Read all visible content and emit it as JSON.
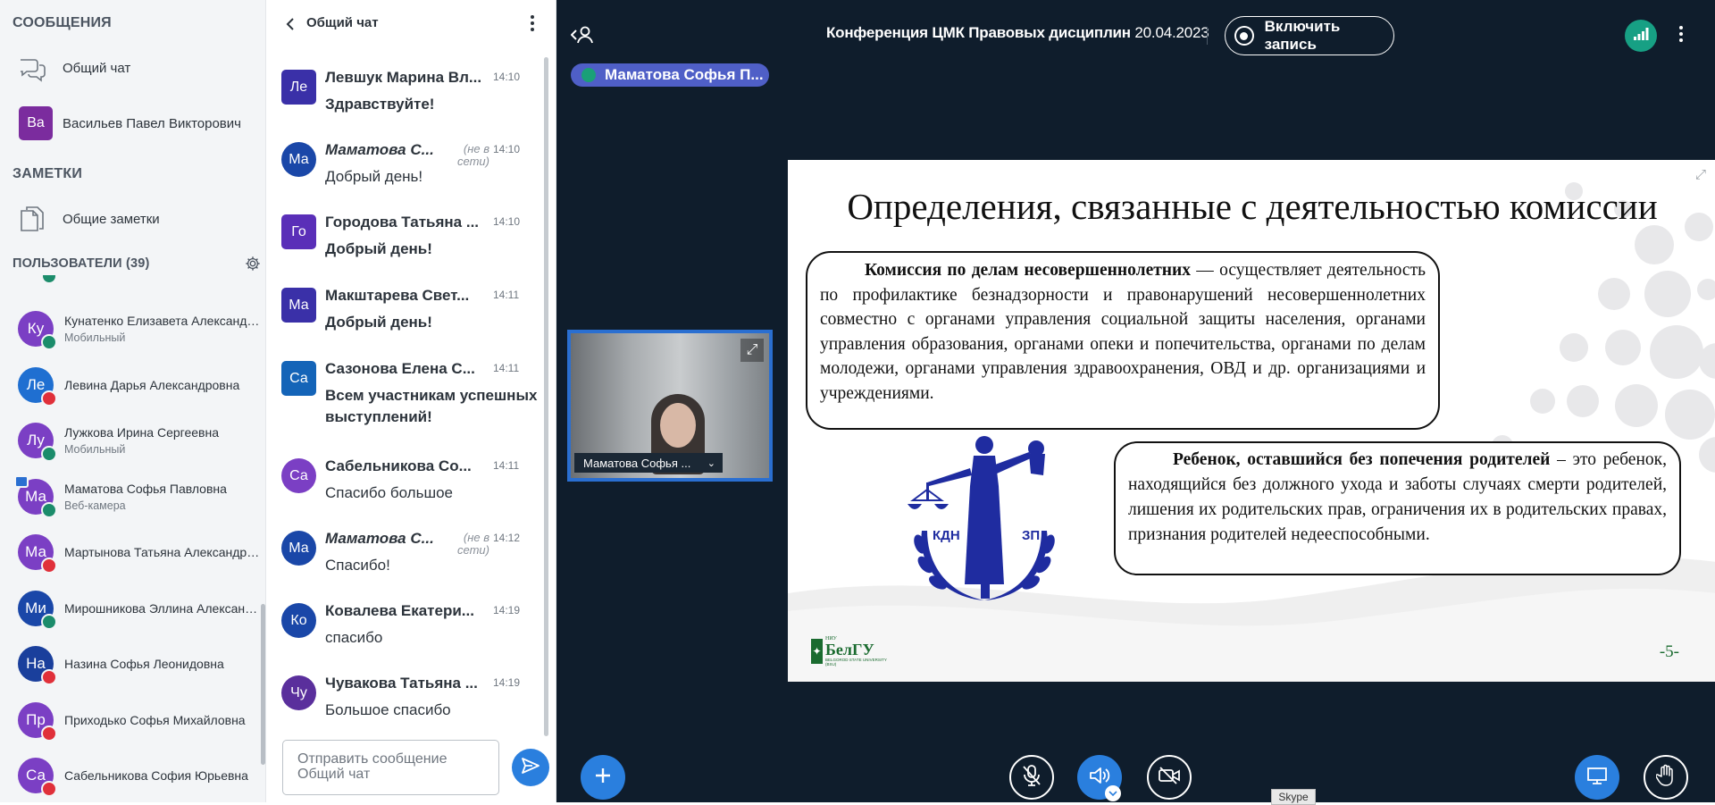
{
  "sidebar": {
    "messages_title": "СООБЩЕНИЯ",
    "public_chat_label": "Общий чат",
    "private_chat": {
      "initials": "Ва",
      "name": "Васильев Павел Викторович",
      "color": "#7b2c9e"
    },
    "notes_title": "ЗАМЕТКИ",
    "shared_notes_label": "Общие заметки",
    "users_title": "ПОЛЬЗОВАТЕЛИ (39)",
    "users": [
      {
        "initials": "Ку",
        "name": "Кунатенко Елизавета Александровна",
        "sub": "Мобильный",
        "color": "#7b3fc4",
        "status": "mic"
      },
      {
        "initials": "Ле",
        "name": "Левина Дарья Александровна",
        "sub": "",
        "color": "#1f6fd1",
        "status": "muted"
      },
      {
        "initials": "Лу",
        "name": "Лужкова Ирина Сергеевна",
        "sub": "Мобильный",
        "color": "#7b3fc4",
        "status": "mic"
      },
      {
        "initials": "Ма",
        "name": "Маматова Софья Павловна",
        "sub": "Веб-камера",
        "color": "#7b3fc4",
        "status": "mic"
      },
      {
        "initials": "Ма",
        "name": "Мартынова Татьяна Александровна",
        "sub": "",
        "color": "#7b3fc4",
        "status": "muted"
      },
      {
        "initials": "Ми",
        "name": "Мирошникова Эллина Александровна",
        "sub": "",
        "color": "#1a47a8",
        "status": "mic"
      },
      {
        "initials": "На",
        "name": "Назина Софья Леонидовна",
        "sub": "",
        "color": "#1a3f9c",
        "status": "muted"
      },
      {
        "initials": "Пр",
        "name": "Приходько Софья Михайловна",
        "sub": "",
        "color": "#7b3fc4",
        "status": "muted"
      },
      {
        "initials": "Са",
        "name": "Сабельникова София Юрьевна",
        "sub": "",
        "color": "#7b3fc4",
        "status": "muted"
      }
    ]
  },
  "chat": {
    "title": "Общий чат",
    "messages": [
      {
        "initials": "Ле",
        "name": "Левшук Марина Вл...",
        "time": "14:10",
        "text": "Здравствуйте!",
        "bold": true,
        "offline": "",
        "color": "#3a30a8",
        "square": true
      },
      {
        "initials": "Ма",
        "name": "Маматова С...",
        "time": "14:10",
        "text": "Добрый день!",
        "bold": false,
        "offline": "(не в сети)",
        "color": "#1a47a8",
        "square": false
      },
      {
        "initials": "Го",
        "name": "Городова Татьяна ...",
        "time": "14:10",
        "text": "Добрый день!",
        "bold": true,
        "offline": "",
        "color": "#5a2fb8",
        "square": true
      },
      {
        "initials": "Ма",
        "name": "Макштарева Свет...",
        "time": "14:11",
        "text": "Добрый день!",
        "bold": true,
        "offline": "",
        "color": "#3a30a8",
        "square": true
      },
      {
        "initials": "Са",
        "name": "Сазонова Елена С...",
        "time": "14:11",
        "text": "Всем участникам успешных выступлений!",
        "bold": true,
        "offline": "",
        "color": "#1464b8",
        "square": true
      },
      {
        "initials": "Са",
        "name": "Сабельникова Со...",
        "time": "14:11",
        "text": "Спасибо большое",
        "bold": false,
        "offline": "",
        "color": "#7b3fc4",
        "square": false
      },
      {
        "initials": "Ма",
        "name": "Маматова С...",
        "time": "14:12",
        "text": "Спасибо!",
        "bold": false,
        "offline": "(не в сети)",
        "color": "#1a47a8",
        "square": false
      },
      {
        "initials": "Ко",
        "name": "Ковалева Екатери...",
        "time": "14:19",
        "text": "спасибо",
        "bold": false,
        "offline": "",
        "color": "#1a47a8",
        "square": false
      },
      {
        "initials": "Чу",
        "name": "Чувакова Татьяна ...",
        "time": "14:19",
        "text": "Большое спасибо",
        "bold": false,
        "offline": "",
        "color": "#5a2f9c",
        "square": false
      }
    ],
    "input_placeholder": "Отправить сообщение Общий чат"
  },
  "stage": {
    "conference_name": "Конференция ЦМК Правовых дисциплин",
    "conference_date": "20.04.2023",
    "record_label": "Включить запись",
    "speaker_label": "Маматова Софья П...",
    "video_name": "Маматова Софья ...",
    "skype_tooltip": "Skype",
    "colors": {
      "stage_bg": "#0f1d2c",
      "accent": "#2a7fde",
      "talking": "#4f5fc7",
      "network": "#17a084"
    }
  },
  "slide": {
    "title": "Определения, связанные с деятельностью комиссии",
    "box1_term": "Комиссия по делам несовершеннолетних",
    "box1_text": " — осуществляет деятельность по профилактике безнадзорности и правонарушений несовершеннолетних совместно с органами управления социальной защиты населения, органами управления образования, органами опеки и попечительства, органами по делам молодежи, органами управления здравоохранения, ОВД и др. организациями и учреждениями.",
    "box2_term": "Ребенок, оставшийся без попечения родителей",
    "box2_text": " – это ребенок, находящийся без должного ухода и заботы случаях смерти родителей, лишения их родительских прав, ограничения их в родительских правах, признания родителей недееспособными.",
    "emblem_left": "КДН",
    "emblem_right": "ЗП",
    "logo_text": "БелГУ",
    "logo_sub": "BELGOROD STATE UNIVERSITY (BSU)",
    "logo_badge": "НИУ",
    "page_number": "-5-"
  }
}
